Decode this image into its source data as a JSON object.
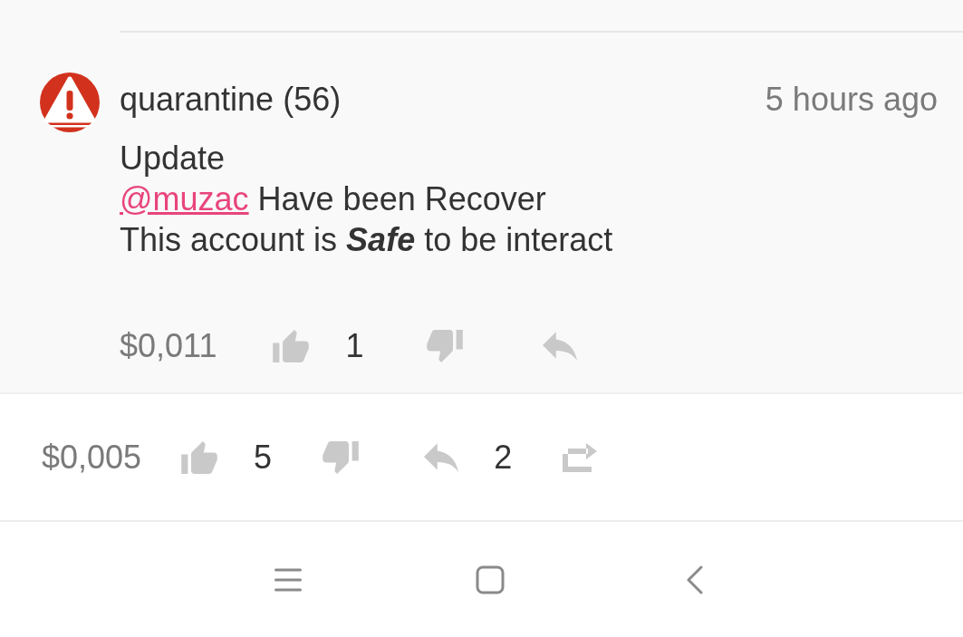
{
  "reply": {
    "author": "quarantine (56)",
    "time": "5 hours ago",
    "lines": [
      {
        "parts": [
          {
            "kind": "text",
            "text": "Update"
          }
        ]
      },
      {
        "parts": [
          {
            "kind": "mention",
            "text": "@muzac"
          },
          {
            "kind": "text",
            "text": " Have been Recover"
          }
        ]
      },
      {
        "parts": [
          {
            "kind": "text",
            "text": "This account is "
          },
          {
            "kind": "bold_italic",
            "text": "Safe"
          },
          {
            "kind": "text",
            "text": " to be interact"
          }
        ]
      }
    ],
    "payout": "$0,011",
    "upvotes": "1"
  },
  "post_footer": {
    "payout": "$0,005",
    "upvotes": "5",
    "replies": "2"
  }
}
